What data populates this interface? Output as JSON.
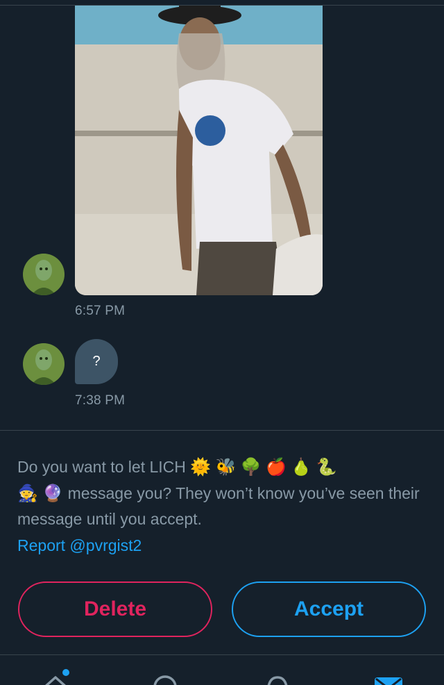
{
  "messages": [
    {
      "type": "image",
      "image_desc": "photo",
      "timestamp": "6:57 PM"
    },
    {
      "type": "text",
      "text": "?",
      "timestamp": "7:38 PM"
    }
  ],
  "request": {
    "line_prefix": "Do you want to let LICH",
    "emojis_line1": [
      "🌞",
      "🐝",
      "🌳",
      "🍎",
      "🍐",
      "🐍"
    ],
    "emojis_line2": [
      "🧙",
      "🔮"
    ],
    "line_suffix": "message you? They won’t know you’ve seen their message until you accept.",
    "report_link": "Report @pvrgist2"
  },
  "actions": {
    "delete_label": "Delete",
    "accept_label": "Accept"
  },
  "tabbar": {
    "icons": [
      "home-icon",
      "search-icon",
      "notifications-icon",
      "messages-icon"
    ],
    "active": "messages-icon"
  },
  "colors": {
    "background": "#15202b",
    "accent": "#1da1f2",
    "danger": "#e0245e",
    "bubble": "#3d5466",
    "secondary_text": "#8899a6"
  }
}
